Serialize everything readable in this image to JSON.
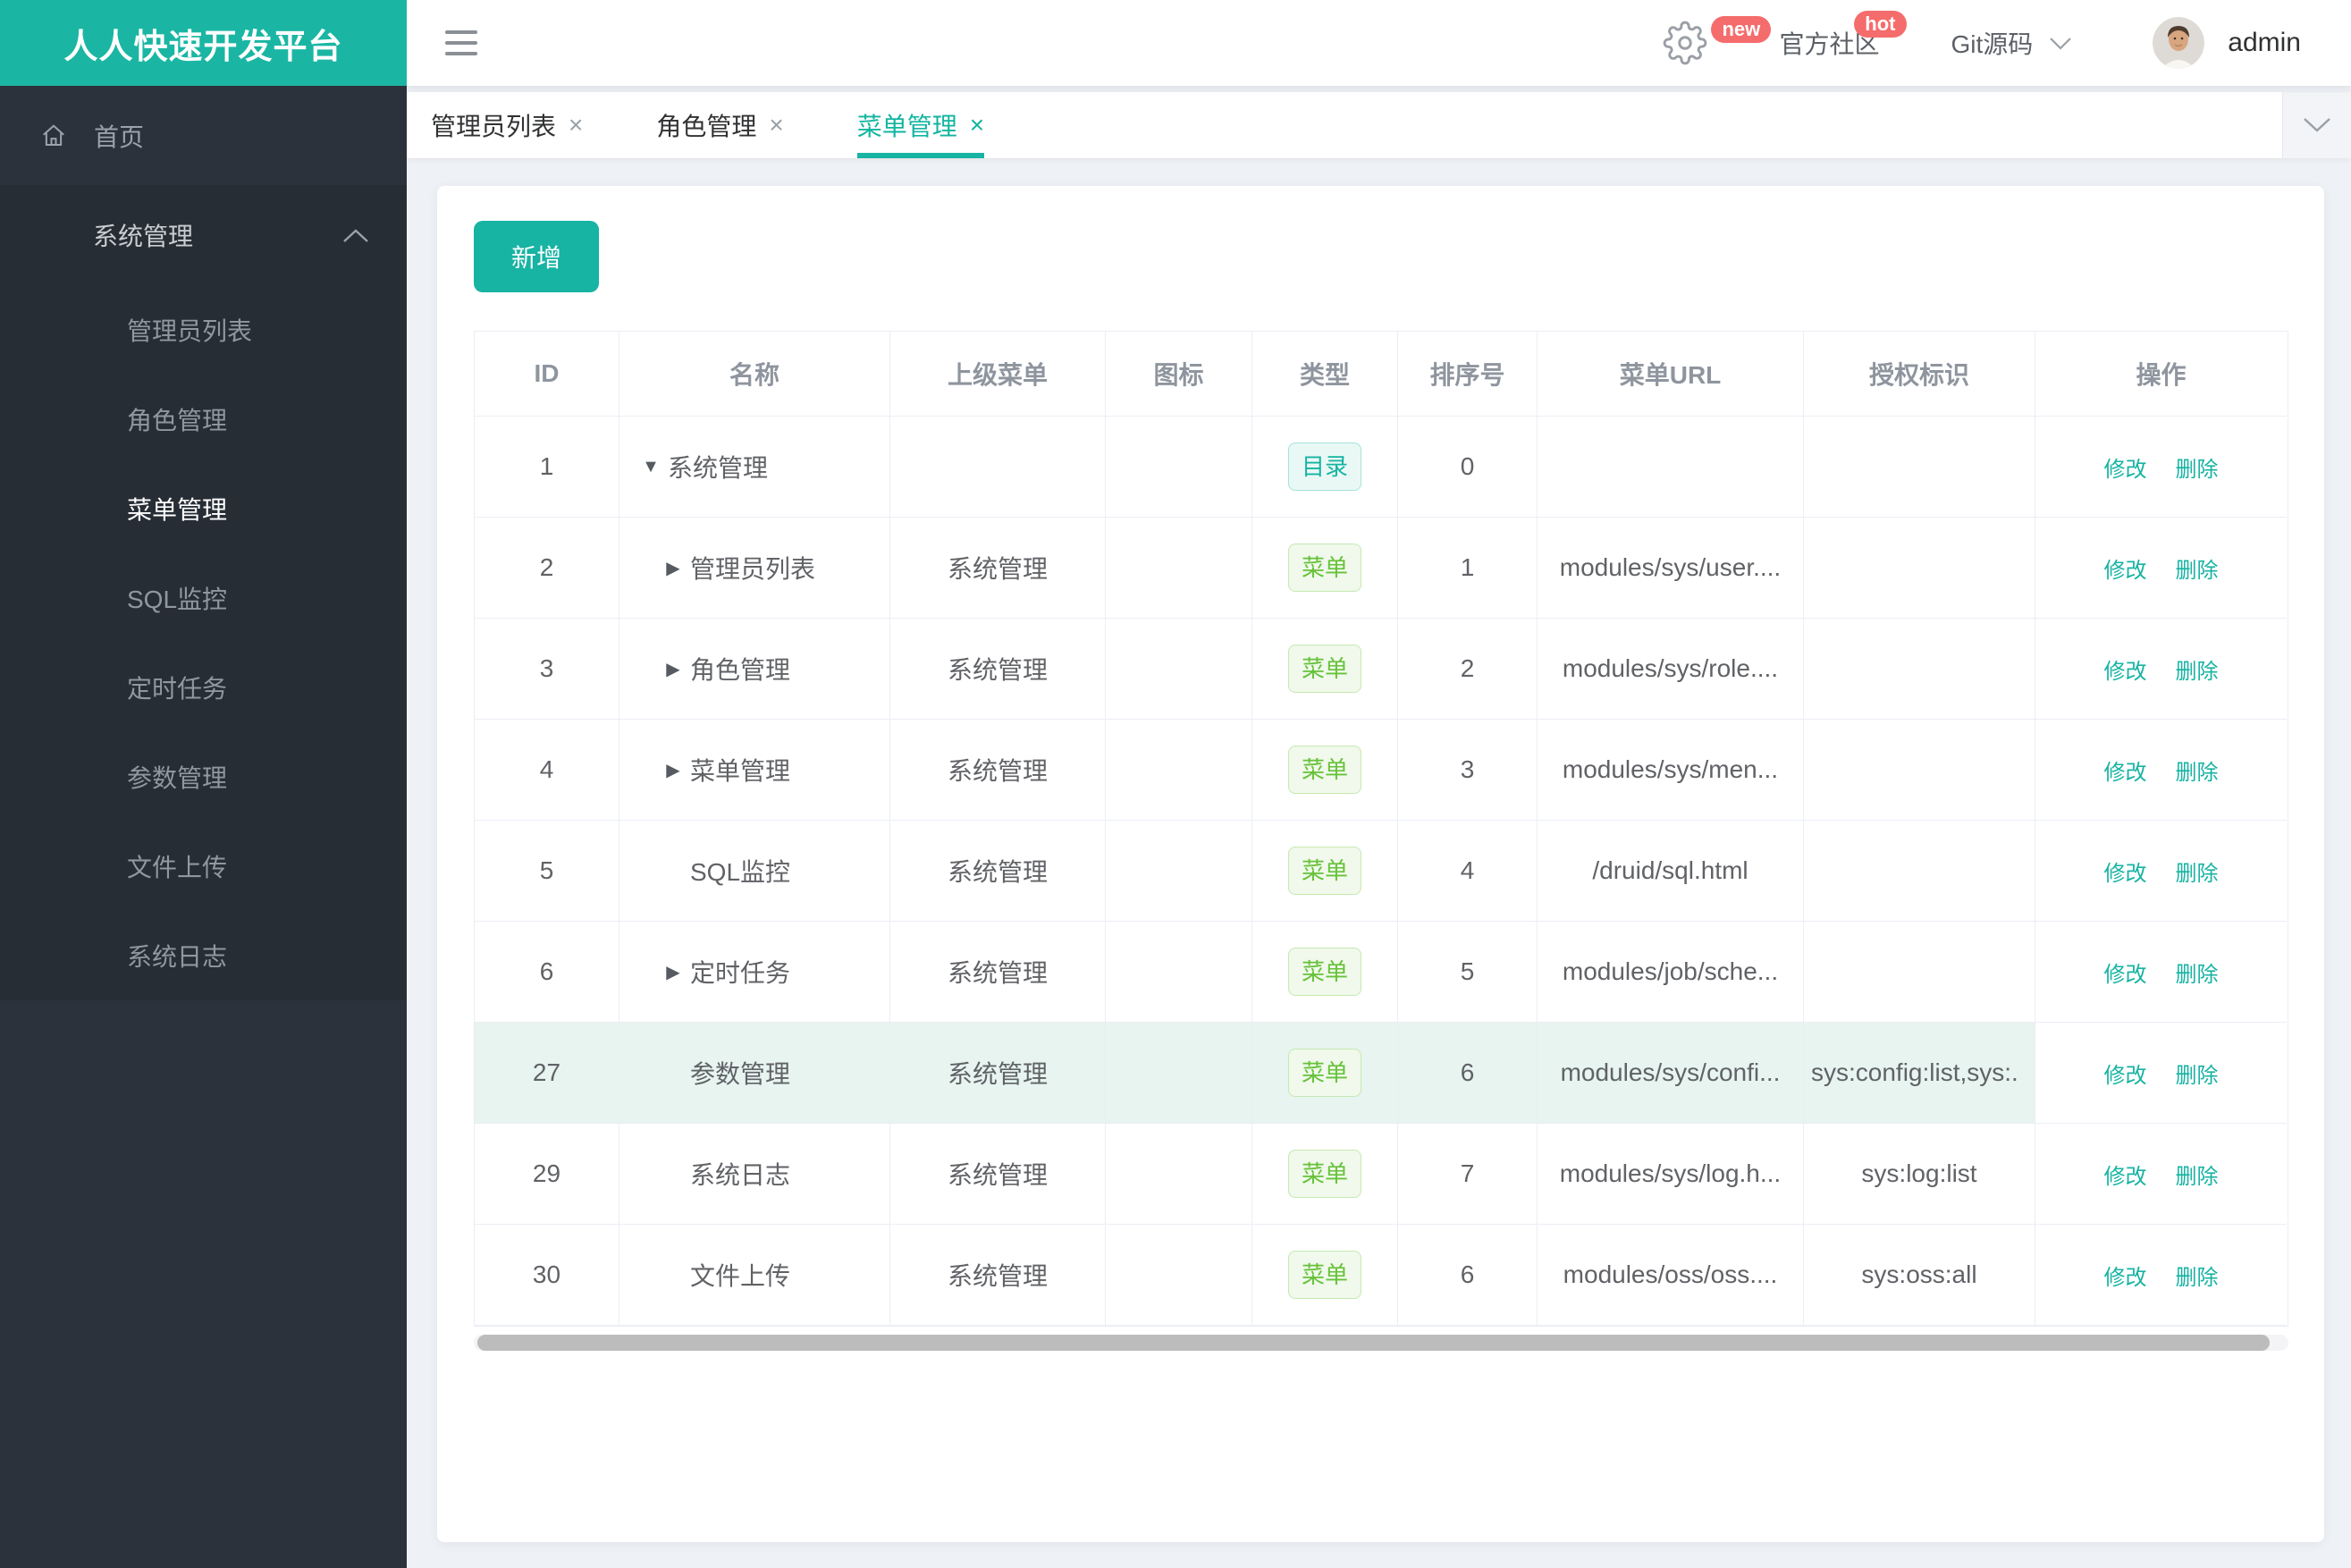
{
  "sidebar": {
    "logo": "人人快速开发平台",
    "home": "首页",
    "group": "系统管理",
    "items": [
      {
        "label": "管理员列表",
        "active": false
      },
      {
        "label": "角色管理",
        "active": false
      },
      {
        "label": "菜单管理",
        "active": true
      },
      {
        "label": "SQL监控",
        "active": false
      },
      {
        "label": "定时任务",
        "active": false
      },
      {
        "label": "参数管理",
        "active": false
      },
      {
        "label": "文件上传",
        "active": false
      },
      {
        "label": "系统日志",
        "active": false
      }
    ]
  },
  "topbar": {
    "badge_new": "new",
    "community": "官方社区",
    "badge_hot": "hot",
    "git": "Git源码",
    "user": "admin"
  },
  "tabs": [
    {
      "label": "管理员列表",
      "active": false
    },
    {
      "label": "角色管理",
      "active": false
    },
    {
      "label": "菜单管理",
      "active": true
    }
  ],
  "toolbar": {
    "add_label": "新增"
  },
  "table": {
    "headers": [
      "ID",
      "名称",
      "上级菜单",
      "图标",
      "类型",
      "排序号",
      "菜单URL",
      "授权标识",
      "操作"
    ],
    "type_labels": {
      "dir": "目录",
      "menu": "菜单"
    },
    "actions": {
      "edit": "修改",
      "delete": "删除"
    },
    "rows": [
      {
        "id": "1",
        "arrow": "down",
        "level": 0,
        "name": "系统管理",
        "parent": "",
        "type": "dir",
        "order": "0",
        "url": "",
        "perm": "",
        "highlight": false
      },
      {
        "id": "2",
        "arrow": "right",
        "level": 1,
        "name": "管理员列表",
        "parent": "系统管理",
        "type": "menu",
        "order": "1",
        "url": "modules/sys/user....",
        "perm": "",
        "highlight": false
      },
      {
        "id": "3",
        "arrow": "right",
        "level": 1,
        "name": "角色管理",
        "parent": "系统管理",
        "type": "menu",
        "order": "2",
        "url": "modules/sys/role....",
        "perm": "",
        "highlight": false
      },
      {
        "id": "4",
        "arrow": "right",
        "level": 1,
        "name": "菜单管理",
        "parent": "系统管理",
        "type": "menu",
        "order": "3",
        "url": "modules/sys/men...",
        "perm": "",
        "highlight": false
      },
      {
        "id": "5",
        "arrow": "",
        "level": 1,
        "name": "SQL监控",
        "parent": "系统管理",
        "type": "menu",
        "order": "4",
        "url": "/druid/sql.html",
        "perm": "",
        "highlight": false
      },
      {
        "id": "6",
        "arrow": "right",
        "level": 1,
        "name": "定时任务",
        "parent": "系统管理",
        "type": "menu",
        "order": "5",
        "url": "modules/job/sche...",
        "perm": "",
        "highlight": false
      },
      {
        "id": "27",
        "arrow": "",
        "level": 1,
        "name": "参数管理",
        "parent": "系统管理",
        "type": "menu",
        "order": "6",
        "url": "modules/sys/confi...",
        "perm": "sys:config:list,sys:.",
        "highlight": true
      },
      {
        "id": "29",
        "arrow": "",
        "level": 1,
        "name": "系统日志",
        "parent": "系统管理",
        "type": "menu",
        "order": "7",
        "url": "modules/sys/log.h...",
        "perm": "sys:log:list",
        "highlight": false
      },
      {
        "id": "30",
        "arrow": "",
        "level": 1,
        "name": "文件上传",
        "parent": "系统管理",
        "type": "menu",
        "order": "6",
        "url": "modules/oss/oss....",
        "perm": "sys:oss:all",
        "highlight": false
      }
    ]
  },
  "colors": {
    "accent": "#17b3a3",
    "logo_bg": "#1abc9c",
    "tag_menu_green": "#67c23a",
    "badge_red": "#f56c6c",
    "row_highlight": "#e7f4f0"
  }
}
